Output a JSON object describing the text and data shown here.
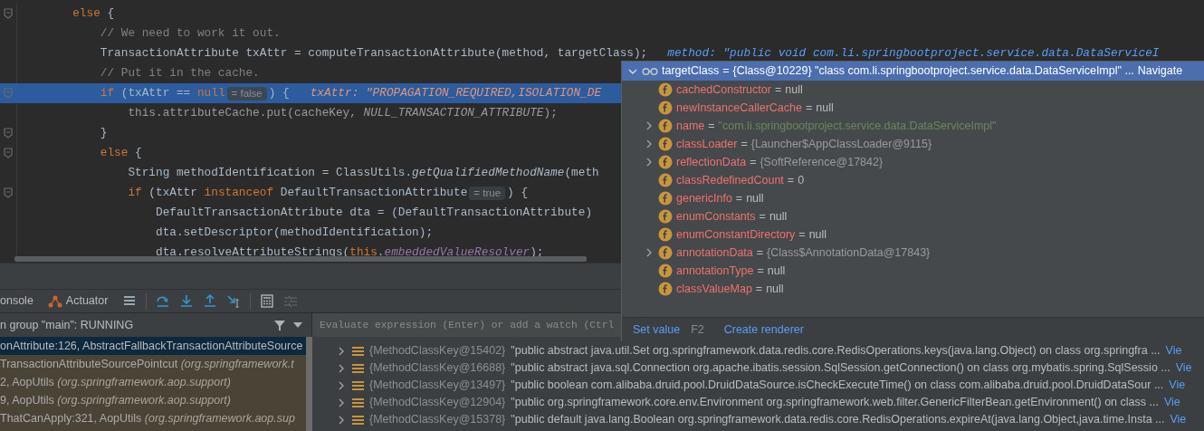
{
  "editor": {
    "lines": [
      {
        "fold": true,
        "execution": false,
        "tokens": [
          {
            "kind": "kw",
            "text": "else"
          },
          {
            "kind": "tx",
            "text": " {"
          }
        ],
        "children": [
          {
            "fold": false,
            "execution": false,
            "tokens": [
              {
                "kind": "cm",
                "text": "// We need to work it out."
              }
            ]
          },
          {
            "fold": false,
            "execution": false,
            "tokens": [
              {
                "kind": "tx",
                "text": "TransactionAttribute txAttr = computeTransactionAttribute(method, targetClass);"
              },
              {
                "kind": "dm",
                "text": "method: \"public void com.li.springbootproject.service.data.DataServiceI"
              }
            ]
          },
          {
            "fold": false,
            "execution": false,
            "tokens": [
              {
                "kind": "cm",
                "text": "// Put it in the cache."
              }
            ]
          },
          {
            "fold": true,
            "execution": true,
            "tokens": [
              {
                "kind": "kw",
                "text": "if"
              },
              {
                "kind": "tx",
                "text": " (txAttr == "
              },
              {
                "kind": "kw",
                "text": "null"
              },
              {
                "kind": "hint",
                "text": "= false"
              },
              {
                "kind": "tx",
                "text": ") {"
              },
              {
                "kind": "dv",
                "text": "txAttr: \"PROPAGATION_REQUIRED,ISOLATION_DE"
              }
            ],
            "children": [
              {
                "fold": false,
                "execution": false,
                "tokens": [
                  {
                    "kind": "dim",
                    "text": "this.attributeCache.put(cacheKey, "
                  },
                  {
                    "kind": "dimit",
                    "text": "NULL_TRANSACTION_ATTRIBUTE"
                  },
                  {
                    "kind": "dim",
                    "text": ");"
                  }
                ]
              }
            ]
          },
          {
            "fold": true,
            "execution": false,
            "tokens": [
              {
                "kind": "tx",
                "text": "}"
              }
            ]
          },
          {
            "fold": true,
            "execution": false,
            "tokens": [
              {
                "kind": "kw",
                "text": "else"
              },
              {
                "kind": "tx",
                "text": " {"
              }
            ],
            "children": [
              {
                "fold": false,
                "execution": false,
                "tokens": [
                  {
                    "kind": "tx",
                    "text": "String methodIdentification = ClassUtils."
                  },
                  {
                    "kind": "it",
                    "text": "getQualifiedMethodName"
                  },
                  {
                    "kind": "tx",
                    "text": "(meth"
                  }
                ]
              },
              {
                "fold": true,
                "execution": false,
                "tokens": [
                  {
                    "kind": "kw",
                    "text": "if"
                  },
                  {
                    "kind": "tx",
                    "text": " (txAttr "
                  },
                  {
                    "kind": "kw",
                    "text": "instanceof"
                  },
                  {
                    "kind": "tx",
                    "text": " DefaultTransactionAttribute"
                  },
                  {
                    "kind": "hint",
                    "text": "= true"
                  },
                  {
                    "kind": "tx",
                    "text": ") {"
                  }
                ],
                "children": [
                  {
                    "fold": false,
                    "execution": false,
                    "tokens": [
                      {
                        "kind": "tx",
                        "text": "DefaultTransactionAttribute dta = (DefaultTransactionAttribute)"
                      }
                    ]
                  },
                  {
                    "fold": false,
                    "execution": false,
                    "tokens": [
                      {
                        "kind": "tx",
                        "text": "dta.setDescriptor(methodIdentification);"
                      }
                    ]
                  },
                  {
                    "fold": false,
                    "execution": false,
                    "tokens": [
                      {
                        "kind": "tx",
                        "text": "dta.resolveAttributeStrings("
                      },
                      {
                        "kind": "kw",
                        "text": "this"
                      },
                      {
                        "kind": "tx",
                        "text": "."
                      },
                      {
                        "kind": "cn",
                        "text": "embeddedValueResolver"
                      },
                      {
                        "kind": "tx",
                        "text": ");"
                      }
                    ]
                  }
                ]
              }
            ]
          }
        ]
      }
    ]
  },
  "toolbar": {
    "tabs": [
      {
        "label": "onsole",
        "icon": false
      },
      {
        "label": "Actuator",
        "icon": true
      }
    ],
    "buttons": [
      {
        "kind": "layout",
        "disabled": false
      },
      {
        "kind": "sep"
      },
      {
        "kind": "step-over",
        "disabled": false
      },
      {
        "kind": "step-into",
        "disabled": false
      },
      {
        "kind": "step-out",
        "disabled": false
      },
      {
        "kind": "run-to-cursor",
        "disabled": false
      },
      {
        "kind": "sep"
      },
      {
        "kind": "evaluate",
        "disabled": false
      },
      {
        "kind": "trace",
        "disabled": true
      }
    ]
  },
  "frames": {
    "title": "n group \"main\": RUNNING",
    "items": [
      {
        "method": "onAttribute:126, AbstractFallbackTransactionAttributeSource",
        "selected": true
      },
      {
        "method": "TransactionAttributeSourcePointcut",
        "package": "(org.springframework.t",
        "selected": false
      },
      {
        "method": "2, AopUtils",
        "package": "(org.springframework.aop.support)",
        "selected": false
      },
      {
        "method": "9, AopUtils",
        "package": "(org.springframework.aop.support)",
        "selected": false
      },
      {
        "method": "ThatCanApply:321, AopUtils",
        "package": "(org.springframework.aop.sup",
        "selected": false
      }
    ]
  },
  "variables": {
    "placeholder": "Evaluate expression (Enter) or add a watch (Ctrl",
    "rows": [
      {
        "expanded": false,
        "key": "{MethodClassKey@15402}",
        "value": "\"public abstract java.util.Set org.springframework.data.redis.core.RedisOperations.keys(java.lang.Object) on class org.springfra ...",
        "link": "Vie"
      },
      {
        "expanded": false,
        "key": "{MethodClassKey@16688}",
        "value": "\"public abstract java.sql.Connection org.apache.ibatis.session.SqlSession.getConnection() on class org.mybatis.spring.SqlSessio ...",
        "link": "Vie"
      },
      {
        "expanded": false,
        "key": "{MethodClassKey@13497}",
        "value": "\"public boolean com.alibaba.druid.pool.DruidDataSource.isCheckExecuteTime() on class com.alibaba.druid.pool.DruidDataSour ...",
        "link": "Vie"
      },
      {
        "expanded": false,
        "key": "{MethodClassKey@12904}",
        "value": "\"public org.springframework.core.env.Environment org.springframework.web.filter.GenericFilterBean.getEnvironment() on class ...",
        "link": "Vie"
      },
      {
        "expanded": false,
        "key": "{MethodClassKey@15378}",
        "value": "\"public default java.lang.Boolean org.springframework.data.redis.core.RedisOperations.expireAt(java.lang.Object,java.time.Insta ...",
        "link": "Vie"
      }
    ]
  },
  "popup": {
    "header": {
      "expanded": true,
      "name": "targetClass",
      "sep": "=",
      "value": "{Class@10229} \"class com.li.springbootproject.service.data.DataServiceImpl\" ...",
      "link": "Navigate"
    },
    "fields": [
      {
        "name": "cachedConstructor",
        "sep": "=",
        "value": "null",
        "kind": "plain",
        "expandable": false
      },
      {
        "name": "newInstanceCallerCache",
        "sep": "=",
        "value": "null",
        "kind": "plain",
        "expandable": false
      },
      {
        "name": "name",
        "sep": "=",
        "value": "\"com.li.springbootproject.service.data.DataServiceImpl\"",
        "kind": "string",
        "expandable": true
      },
      {
        "name": "classLoader",
        "sep": "=",
        "value": "{Launcher$AppClassLoader@9115}",
        "kind": "ref",
        "expandable": true
      },
      {
        "name": "reflectionData",
        "sep": "=",
        "value": "{SoftReference@17842}",
        "kind": "ref",
        "expandable": true
      },
      {
        "name": "classRedefinedCount",
        "sep": "=",
        "value": "0",
        "kind": "plain",
        "expandable": false
      },
      {
        "name": "genericInfo",
        "sep": "=",
        "value": "null",
        "kind": "plain",
        "expandable": false
      },
      {
        "name": "enumConstants",
        "sep": "=",
        "value": "null",
        "kind": "plain",
        "expandable": false
      },
      {
        "name": "enumConstantDirectory",
        "sep": "=",
        "value": "null",
        "kind": "plain",
        "expandable": false
      },
      {
        "name": "annotationData",
        "sep": "=",
        "value": "{Class$AnnotationData@17843}",
        "kind": "ref",
        "expandable": true
      },
      {
        "name": "annotationType",
        "sep": "=",
        "value": "null",
        "kind": "plain",
        "expandable": false
      },
      {
        "name": "classValueMap",
        "sep": "=",
        "value": "null",
        "kind": "plain",
        "expandable": false
      }
    ],
    "actions": [
      {
        "label": "Set value",
        "shortcut": "F2"
      },
      {
        "label": "Create renderer"
      }
    ]
  }
}
